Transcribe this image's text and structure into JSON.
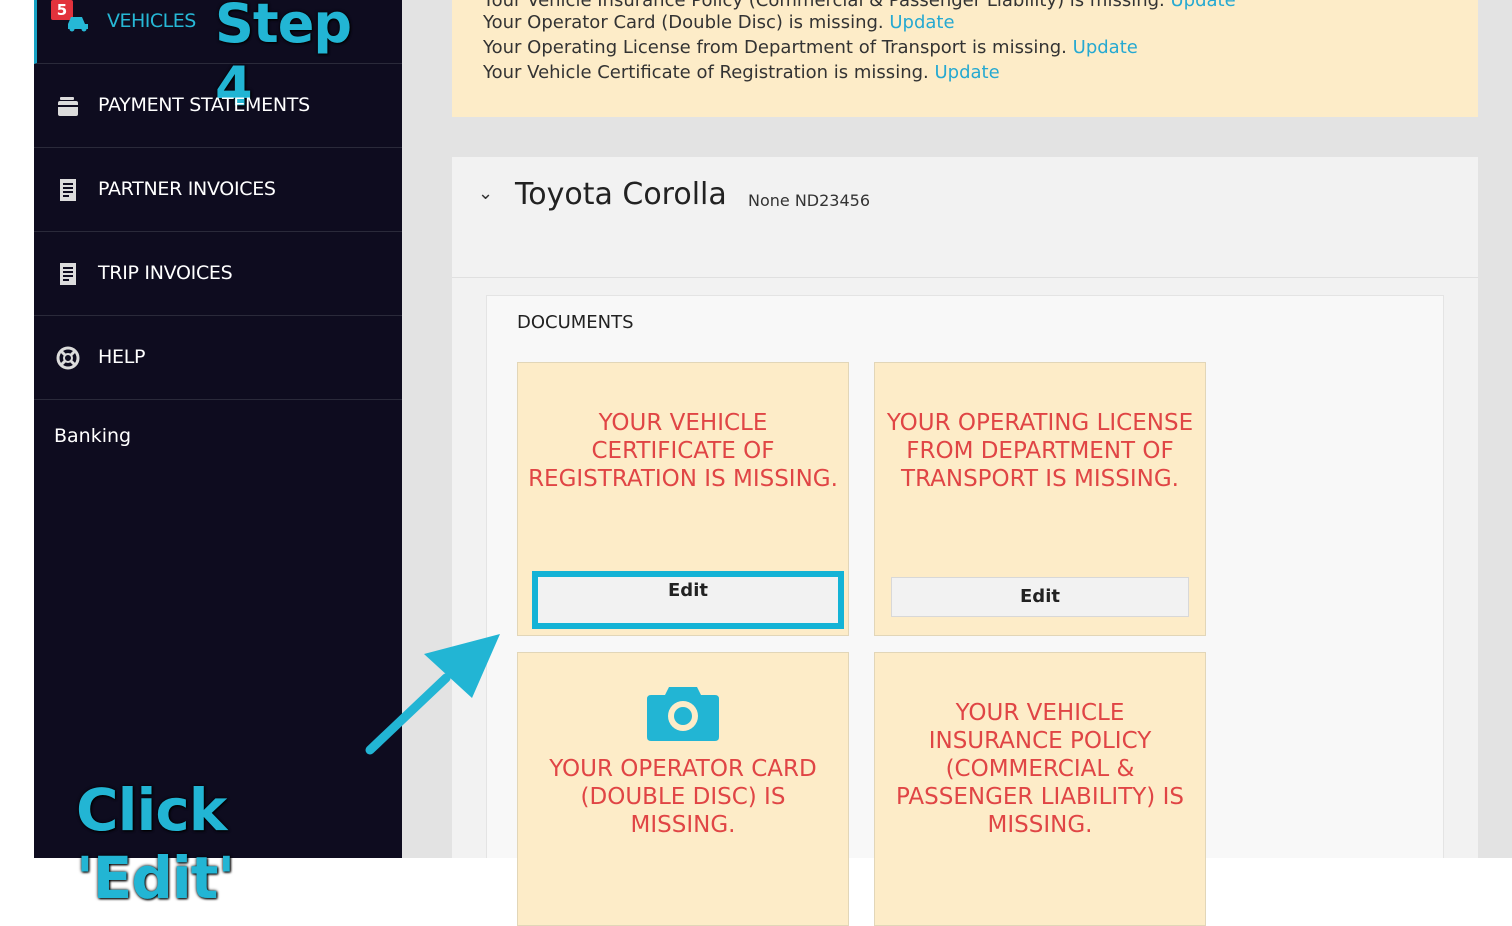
{
  "sidebar": {
    "active_badge": "5",
    "active_label": "VEHICLES",
    "step_overlay": "Step 4",
    "items": [
      {
        "label": "PAYMENT STATEMENTS",
        "icon": "wallet-icon"
      },
      {
        "label": "PARTNER INVOICES",
        "icon": "document-icon"
      },
      {
        "label": "TRIP INVOICES",
        "icon": "document-icon"
      },
      {
        "label": "HELP",
        "icon": "lifebuoy-icon"
      }
    ],
    "banking": "Banking",
    "click_overlay": "Click 'Edit'"
  },
  "alert": {
    "lines": [
      {
        "text": "Your Vehicle Insurance Policy (Commercial & Passenger Liability) is missing.",
        "link": "Update"
      },
      {
        "text": "Your Operator Card (Double Disc) is missing.",
        "link": "Update"
      },
      {
        "text": "Your Operating License from Department of Transport is missing.",
        "link": "Update"
      },
      {
        "text": "Your Vehicle Certificate of Registration is missing.",
        "link": "Update"
      }
    ]
  },
  "vehicle": {
    "title": "Toyota Corolla",
    "plate": "None ND23456",
    "documents_heading": "DOCUMENTS",
    "documents": [
      {
        "message": "YOUR VEHICLE CERTIFICATE OF REGISTRATION IS MISSING.",
        "button": "Edit"
      },
      {
        "message": "YOUR OPERATING LICENSE FROM DEPARTMENT OF TRANSPORT IS MISSING.",
        "button": "Edit"
      },
      {
        "message": "YOUR OPERATOR CARD (DOUBLE DISC) IS MISSING.",
        "icon": "camera-icon"
      },
      {
        "message": "YOUR VEHICLE INSURANCE POLICY (COMMERCIAL & PASSENGER LIABILITY) IS MISSING."
      }
    ]
  },
  "colors": {
    "sidebar_bg": "#0e0c1f",
    "accent_cyan": "#14b3d6",
    "alert_bg": "#fdecc8",
    "missing_text": "#e04545",
    "link": "#26a9d1"
  }
}
